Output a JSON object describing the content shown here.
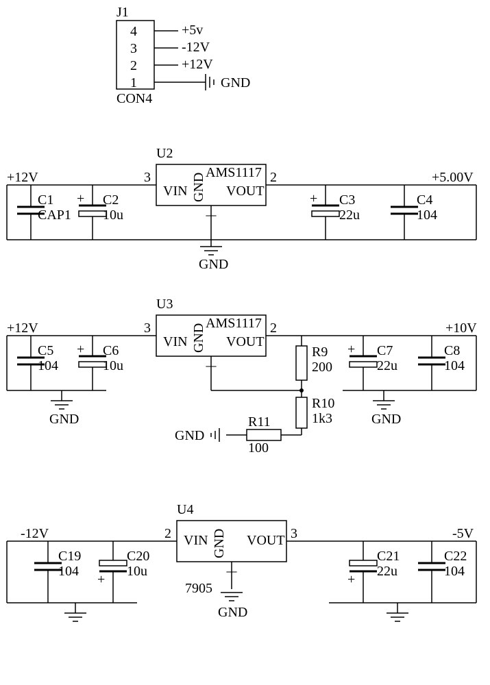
{
  "connector": {
    "ref": "J1",
    "type": "CON4",
    "pins": [
      "4",
      "3",
      "2",
      "1"
    ],
    "nets": [
      "+5v",
      "-12V",
      "+12V",
      "GND"
    ]
  },
  "reg1": {
    "ref": "U2",
    "part": "AMS1117",
    "vin_net": "+12V",
    "vout_net": "+5.00V",
    "pin_in": "3",
    "pin_out": "2",
    "pins": {
      "vin": "VIN",
      "gnd": "GND",
      "vout": "VOUT"
    },
    "gnd": "GND",
    "caps": {
      "c1": {
        "ref": "C1",
        "val": "CAP1"
      },
      "c2": {
        "ref": "C2",
        "val": "10u"
      },
      "c3": {
        "ref": "C3",
        "val": "22u"
      },
      "c4": {
        "ref": "C4",
        "val": "104"
      }
    }
  },
  "reg2": {
    "ref": "U3",
    "part": "AMS1117",
    "vin_net": "+12V",
    "vout_net": "+10V",
    "pin_in": "3",
    "pin_out": "2",
    "pins": {
      "vin": "VIN",
      "gnd": "GND",
      "vout": "VOUT"
    },
    "gnd": "GND",
    "gnd2": "GND",
    "caps": {
      "c5": {
        "ref": "C5",
        "val": "104"
      },
      "c6": {
        "ref": "C6",
        "val": "10u"
      },
      "c7": {
        "ref": "C7",
        "val": "22u"
      },
      "c8": {
        "ref": "C8",
        "val": "104"
      }
    },
    "res": {
      "r9": {
        "ref": "R9",
        "val": "200"
      },
      "r10": {
        "ref": "R10",
        "val": "1k3"
      },
      "r11": {
        "ref": "R11",
        "val": "100"
      }
    }
  },
  "reg3": {
    "ref": "U4",
    "part": "7905",
    "vin_net": "-12V",
    "vout_net": "-5V",
    "pin_in": "2",
    "pin_out": "3",
    "pins": {
      "vin": "VIN",
      "gnd": "GND",
      "vout": "VOUT"
    },
    "gnd": "GND",
    "caps": {
      "c19": {
        "ref": "C19",
        "val": "104"
      },
      "c20": {
        "ref": "C20",
        "val": "10u"
      },
      "c21": {
        "ref": "C21",
        "val": "22u"
      },
      "c22": {
        "ref": "C22",
        "val": "104"
      }
    }
  },
  "chart_data": {
    "type": "table",
    "title": "Schematic: power connector + three voltage regulators",
    "connector": {
      "ref": "J1",
      "type": "CON4",
      "pins": [
        [
          4,
          "+5v"
        ],
        [
          3,
          "-12V"
        ],
        [
          2,
          "+12V"
        ],
        [
          1,
          "GND"
        ]
      ]
    },
    "regulators": [
      {
        "ref": "U2",
        "part": "AMS1117",
        "in": "+12V",
        "out": "+5.00V",
        "caps_in": [
          [
            "C1",
            "CAP1"
          ],
          [
            "C2",
            "10u"
          ]
        ],
        "caps_out": [
          [
            "C3",
            "22u"
          ],
          [
            "C4",
            "104"
          ]
        ]
      },
      {
        "ref": "U3",
        "part": "AMS1117",
        "in": "+12V",
        "out": "+10V",
        "caps_in": [
          [
            "C5",
            "104"
          ],
          [
            "C6",
            "10u"
          ]
        ],
        "caps_out": [
          [
            "C7",
            "22u"
          ],
          [
            "C8",
            "104"
          ]
        ],
        "feedback": [
          [
            "R9",
            "200"
          ],
          [
            "R10",
            "1k3"
          ],
          [
            "R11",
            "100"
          ]
        ]
      },
      {
        "ref": "U4",
        "part": "7905",
        "in": "-12V",
        "out": "-5V",
        "caps_in": [
          [
            "C19",
            "104"
          ],
          [
            "C20",
            "10u"
          ]
        ],
        "caps_out": [
          [
            "C21",
            "22u"
          ],
          [
            "C22",
            "104"
          ]
        ]
      }
    ]
  }
}
